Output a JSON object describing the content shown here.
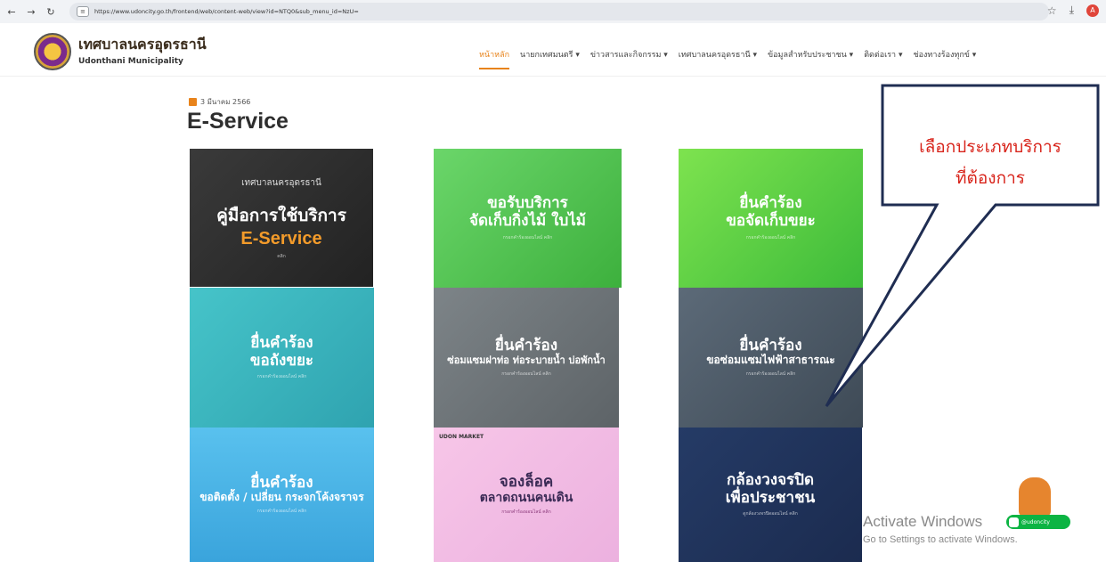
{
  "browser": {
    "url": "https://www.udoncity.go.th/frontend/web/content-web/view?id=NTQ0&sub_menu_id=NzU=",
    "profile_initial": "A"
  },
  "site": {
    "name_th": "เทศบาลนครอุดรธานี",
    "name_en": "Udonthani Municipality"
  },
  "menu": [
    {
      "label": "หน้าหลัก"
    },
    {
      "label": "นายกเทศมนตรี ▾"
    },
    {
      "label": "ข่าวสารและกิจกรรม ▾"
    },
    {
      "label": "เทศบาลนครอุดรธานี ▾"
    },
    {
      "label": "ข้อมูลสำหรับประชาชน ▾"
    },
    {
      "label": "ติดต่อเรา ▾"
    },
    {
      "label": "ช่องทางร้องทุกข์ ▾"
    }
  ],
  "page": {
    "date": "3 มีนาคม 2566",
    "title": "E-Service"
  },
  "tiles": [
    {
      "l1": "เทศบาลนครอุดรธานี",
      "l2": "คู่มือการใช้บริการ",
      "l3": "E-Service",
      "small": "คลิก"
    },
    {
      "l1": "ขอรับบริการ",
      "l2": "จัดเก็บกิ่งไม้ ใบไม้",
      "small": "กรอกคำร้องออนไลน์ คลิก"
    },
    {
      "l1": "ยื่นคำร้อง",
      "l2": "ขอจัดเก็บขยะ",
      "small": "กรอกคำร้องออนไลน์ คลิก"
    },
    {
      "l1": "ยื่นคำร้อง",
      "l2": "ขอถังขยะ",
      "small": "กรอกคำร้องออนไลน์ คลิก"
    },
    {
      "l1": "ยื่นคำร้อง",
      "l2": "ซ่อมแซมฝาท่อ ท่อระบายน้ำ บ่อพักน้ำ",
      "small": "กรอกคำร้องออนไลน์ คลิก"
    },
    {
      "l1": "ยื่นคำร้อง",
      "l2": "ขอซ่อมแซมไฟฟ้าสาธารณะ",
      "small": "กรอกคำร้องออนไลน์ คลิก"
    },
    {
      "l1": "ยื่นคำร้อง",
      "l2": "ขอติดตั้ง / เปลี่ยน กระจกโค้งจราจร",
      "small": "กรอกคำร้องออนไลน์ คลิก"
    },
    {
      "tag": "UDON MARKET",
      "l1": "จองล็อค",
      "l2": "ตลาดถนนคนเดิน",
      "small": "กรอกคำร้องออนไลน์ คลิก"
    },
    {
      "l1": "กล้องวงจรปิด",
      "l2": "เพื่อประชาชน",
      "small": "ดูกล้องวงจรปิดออนไลน์ คลิก"
    }
  ],
  "callout": {
    "line1": "เลือกประเภทบริการ",
    "line2": "ที่ต้องการ"
  },
  "watermark": {
    "title": "Activate Windows",
    "subtitle": "Go to Settings to activate Windows."
  },
  "line_badge": {
    "label": "@udoncity"
  }
}
